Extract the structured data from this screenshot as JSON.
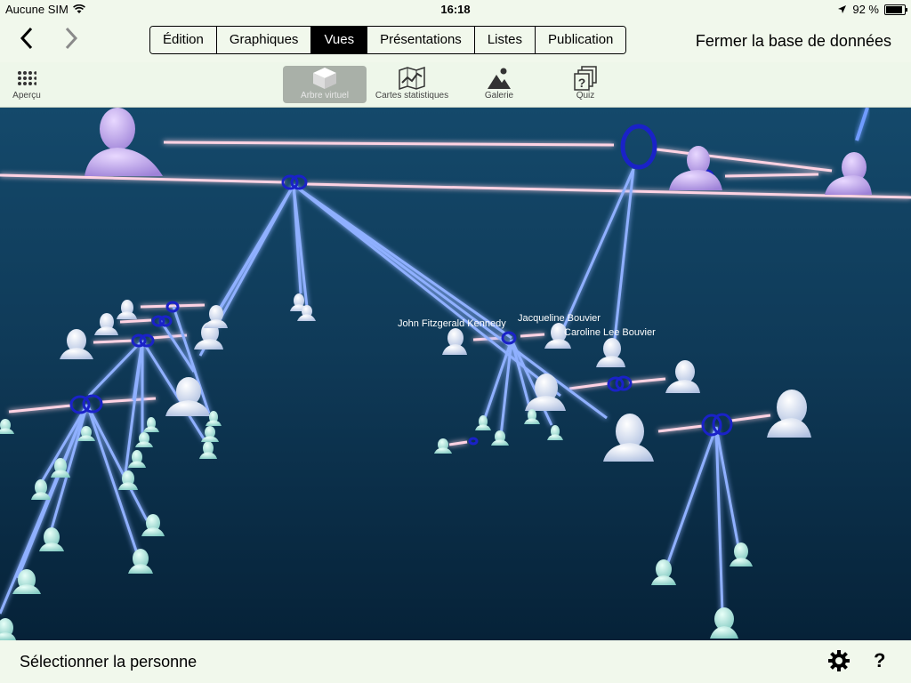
{
  "status": {
    "carrier": "Aucune SIM",
    "time": "16:18",
    "battery": "92 %",
    "battery_level": 0.92
  },
  "nav": {
    "back_icon": "chevron-left-icon",
    "forward_icon": "chevron-right-icon",
    "tabs": [
      "Édition",
      "Graphiques",
      "Vues",
      "Présentations",
      "Listes",
      "Publication"
    ],
    "active_tab": "Vues",
    "close_label": "Fermer la base de données"
  },
  "toolbar": {
    "overview": {
      "label": "Aperçu",
      "icon": "grid-icon"
    },
    "views": [
      {
        "label": "Arbre virtuel",
        "icon": "cube-icon",
        "active": true
      },
      {
        "label": "Cartes statistiques",
        "icon": "map-chart-icon"
      },
      {
        "label": "Galerie",
        "icon": "gallery-icon"
      },
      {
        "label": "Quiz",
        "icon": "quiz-icon"
      }
    ]
  },
  "tree": {
    "names": [
      "John Fitzgerald Kennedy",
      "Jacqueline Bouvier",
      "Caroline Lee Bouvier"
    ]
  },
  "bottom": {
    "select_label": "Sélectionner la personne",
    "settings_icon": "gear-icon",
    "help_label": "?"
  }
}
